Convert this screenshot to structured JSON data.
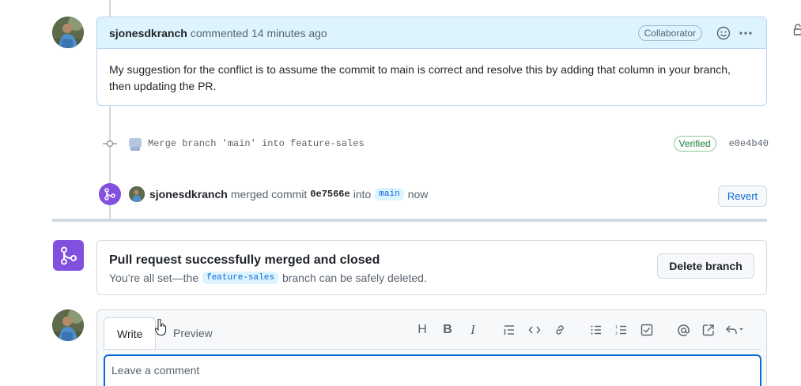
{
  "comment": {
    "author": "sjonesdkranch",
    "action": "commented",
    "time": "14 minutes ago",
    "role_badge": "Collaborator",
    "body": "My suggestion for the conflict is to assume the commit to main is correct and resolve this by adding that column in your branch, then updating the PR."
  },
  "commit": {
    "message": "Merge branch 'main' into feature-sales",
    "verified_label": "Verified",
    "sha": "e0e4b40"
  },
  "merge_event": {
    "author": "sjonesdkranch",
    "action": "merged commit",
    "sha": "0e7566e",
    "into": "into",
    "branch": "main",
    "time": "now",
    "revert_label": "Revert"
  },
  "merge_status": {
    "title": "Pull request successfully merged and closed",
    "sub_prefix": "You’re all set—the",
    "branch": "feature-sales",
    "sub_suffix": "branch can be safely deleted.",
    "delete_label": "Delete branch"
  },
  "editor": {
    "tab_write": "Write",
    "tab_preview": "Preview",
    "placeholder": "Leave a comment",
    "toolbar": [
      "heading-icon",
      "bold-icon",
      "italic-icon",
      "quote-icon",
      "code-icon",
      "link-icon",
      "unordered-list-icon",
      "ordered-list-icon",
      "task-list-icon",
      "mention-icon",
      "reference-icon",
      "saved-reply-icon"
    ]
  },
  "colors": {
    "accent": "#0969da",
    "merged_purple": "#8250df",
    "verified_green": "#1a7f37",
    "comment_header_bg": "#ddf4ff"
  }
}
